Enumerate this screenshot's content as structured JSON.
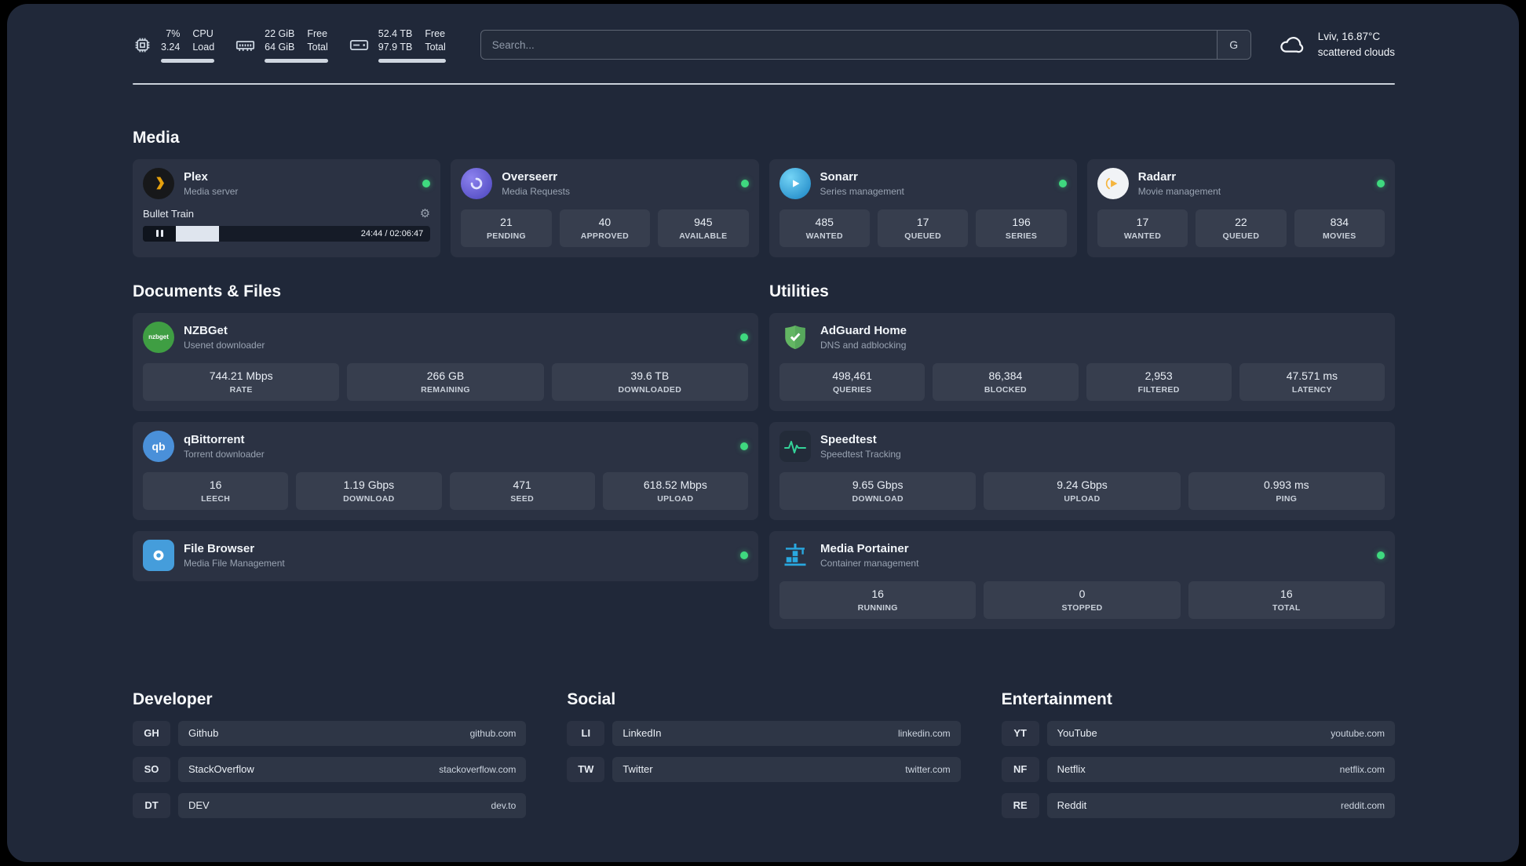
{
  "topbar": {
    "cpu": {
      "value_top": "7%",
      "value_bottom": "3.24",
      "label_top": "CPU",
      "label_bottom": "Load"
    },
    "ram": {
      "value_top": "22 GiB",
      "value_bottom": "64 GiB",
      "label_top": "Free",
      "label_bottom": "Total"
    },
    "disk": {
      "value_top": "52.4 TB",
      "value_bottom": "97.9 TB",
      "label_top": "Free",
      "label_bottom": "Total"
    },
    "search": {
      "placeholder": "Search...",
      "engine_label": "G"
    },
    "weather": {
      "location": "Lviv, 16.87°C",
      "condition": "scattered clouds"
    }
  },
  "media": {
    "title": "Media",
    "plex": {
      "name": "Plex",
      "subtitle": "Media server",
      "now_playing": "Bullet Train",
      "time": "24:44 / 02:06:47",
      "progress_percent": 17
    },
    "overseerr": {
      "name": "Overseerr",
      "subtitle": "Media Requests",
      "stats": [
        {
          "value": "21",
          "label": "PENDING"
        },
        {
          "value": "40",
          "label": "APPROVED"
        },
        {
          "value": "945",
          "label": "AVAILABLE"
        }
      ]
    },
    "sonarr": {
      "name": "Sonarr",
      "subtitle": "Series management",
      "stats": [
        {
          "value": "485",
          "label": "WANTED"
        },
        {
          "value": "17",
          "label": "QUEUED"
        },
        {
          "value": "196",
          "label": "SERIES"
        }
      ]
    },
    "radarr": {
      "name": "Radarr",
      "subtitle": "Movie management",
      "stats": [
        {
          "value": "17",
          "label": "WANTED"
        },
        {
          "value": "22",
          "label": "QUEUED"
        },
        {
          "value": "834",
          "label": "MOVIES"
        }
      ]
    }
  },
  "documents": {
    "title": "Documents & Files",
    "nzbget": {
      "name": "NZBGet",
      "subtitle": "Usenet downloader",
      "icon_text": "nzbget",
      "stats": [
        {
          "value": "744.21 Mbps",
          "label": "RATE"
        },
        {
          "value": "266 GB",
          "label": "REMAINING"
        },
        {
          "value": "39.6 TB",
          "label": "DOWNLOADED"
        }
      ]
    },
    "qbittorrent": {
      "name": "qBittorrent",
      "subtitle": "Torrent downloader",
      "icon_text": "qb",
      "stats": [
        {
          "value": "16",
          "label": "LEECH"
        },
        {
          "value": "1.19 Gbps",
          "label": "DOWNLOAD"
        },
        {
          "value": "471",
          "label": "SEED"
        },
        {
          "value": "618.52 Mbps",
          "label": "UPLOAD"
        }
      ]
    },
    "filebrowser": {
      "name": "File Browser",
      "subtitle": "Media File Management"
    }
  },
  "utilities": {
    "title": "Utilities",
    "adguard": {
      "name": "AdGuard Home",
      "subtitle": "DNS and adblocking",
      "stats": [
        {
          "value": "498,461",
          "label": "QUERIES"
        },
        {
          "value": "86,384",
          "label": "BLOCKED"
        },
        {
          "value": "2,953",
          "label": "FILTERED"
        },
        {
          "value": "47.571 ms",
          "label": "LATENCY"
        }
      ]
    },
    "speedtest": {
      "name": "Speedtest",
      "subtitle": "Speedtest Tracking",
      "stats": [
        {
          "value": "9.65 Gbps",
          "label": "DOWNLOAD"
        },
        {
          "value": "9.24 Gbps",
          "label": "UPLOAD"
        },
        {
          "value": "0.993 ms",
          "label": "PING"
        }
      ]
    },
    "portainer": {
      "name": "Media Portainer",
      "subtitle": "Container management",
      "stats": [
        {
          "value": "16",
          "label": "RUNNING"
        },
        {
          "value": "0",
          "label": "STOPPED"
        },
        {
          "value": "16",
          "label": "TOTAL"
        }
      ]
    }
  },
  "links": {
    "developer": {
      "title": "Developer",
      "items": [
        {
          "abbr": "GH",
          "name": "Github",
          "url": "github.com"
        },
        {
          "abbr": "SO",
          "name": "StackOverflow",
          "url": "stackoverflow.com"
        },
        {
          "abbr": "DT",
          "name": "DEV",
          "url": "dev.to"
        }
      ]
    },
    "social": {
      "title": "Social",
      "items": [
        {
          "abbr": "LI",
          "name": "LinkedIn",
          "url": "linkedin.com"
        },
        {
          "abbr": "TW",
          "name": "Twitter",
          "url": "twitter.com"
        }
      ]
    },
    "entertainment": {
      "title": "Entertainment",
      "items": [
        {
          "abbr": "YT",
          "name": "YouTube",
          "url": "youtube.com"
        },
        {
          "abbr": "NF",
          "name": "Netflix",
          "url": "netflix.com"
        },
        {
          "abbr": "RE",
          "name": "Reddit",
          "url": "reddit.com"
        }
      ]
    }
  },
  "colors": {
    "status_online": "#3fd97f",
    "plex_amber": "#e5a00d",
    "adguard_green": "#63b663",
    "speedtest_green": "#34d399",
    "portainer_blue": "#29a8e0"
  }
}
